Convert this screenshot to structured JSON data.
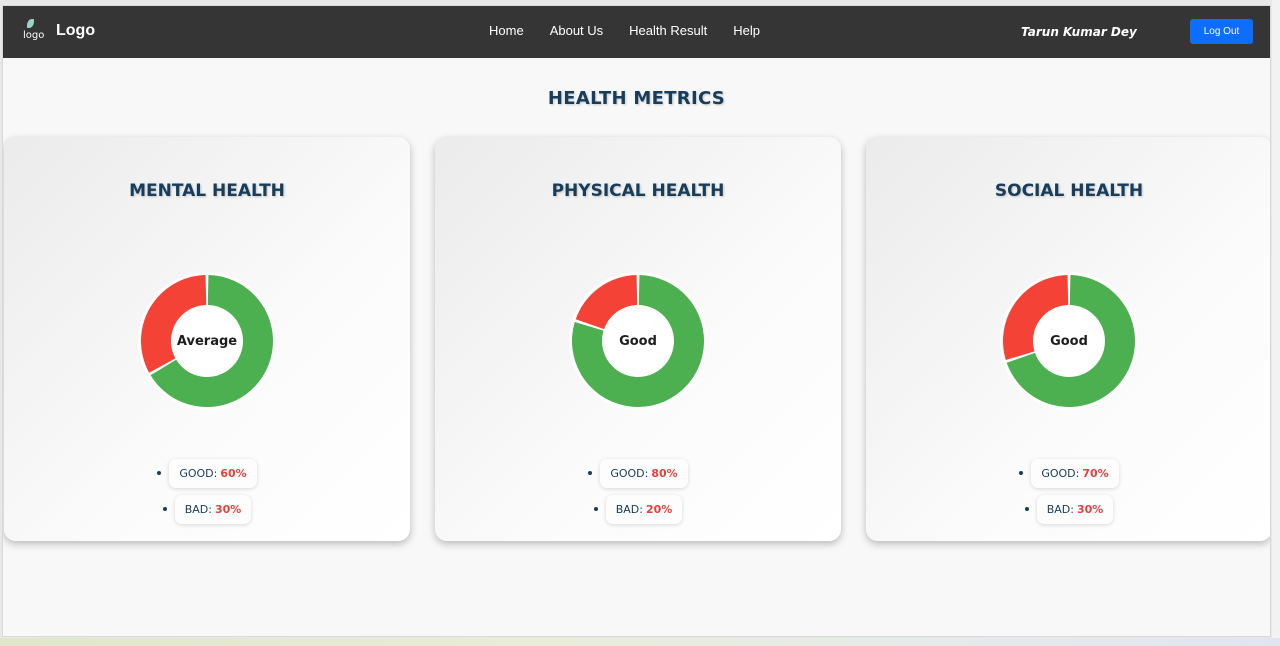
{
  "navbar": {
    "logo_alt": "logo",
    "brand": "Logo",
    "links": [
      "Home",
      "About Us",
      "Health Result",
      "Help"
    ],
    "user_name": "Tarun Kumar Dey",
    "logout_label": "Log Out"
  },
  "page_title": "HEALTH METRICS",
  "colors": {
    "good": "#4caf50",
    "bad": "#f44336",
    "title": "#173d5a",
    "nav_bg": "#353535",
    "button": "#0d6efd"
  },
  "cards": [
    {
      "title": "MENTAL HEALTH",
      "status": "Average",
      "good_label": "GOOD:",
      "good_value": "60%",
      "bad_label": "BAD:",
      "bad_value": "30%"
    },
    {
      "title": "PHYSICAL HEALTH",
      "status": "Good",
      "good_label": "GOOD:",
      "good_value": "80%",
      "bad_label": "BAD:",
      "bad_value": "20%"
    },
    {
      "title": "SOCIAL HEALTH",
      "status": "Good",
      "good_label": "GOOD:",
      "good_value": "70%",
      "bad_label": "BAD:",
      "bad_value": "30%"
    }
  ],
  "chart_data": [
    {
      "type": "pie",
      "categories": [
        "GOOD",
        "BAD"
      ],
      "values": [
        60,
        30
      ],
      "title": "MENTAL HEALTH"
    },
    {
      "type": "pie",
      "categories": [
        "GOOD",
        "BAD"
      ],
      "values": [
        80,
        20
      ],
      "title": "PHYSICAL HEALTH"
    },
    {
      "type": "pie",
      "categories": [
        "GOOD",
        "BAD"
      ],
      "values": [
        70,
        30
      ],
      "title": "SOCIAL HEALTH"
    }
  ]
}
